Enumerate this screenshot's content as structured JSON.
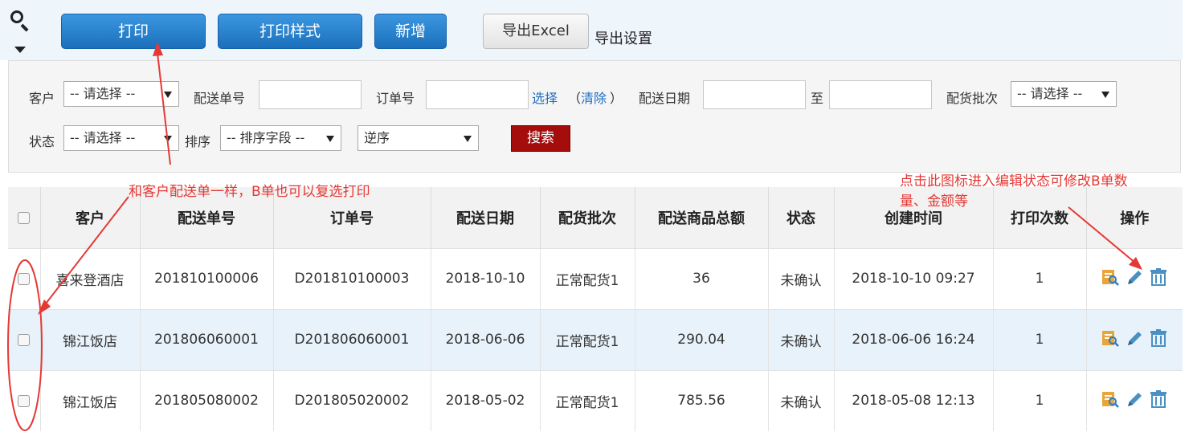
{
  "toolbar": {
    "print_label": "打印",
    "print_style_label": "打印样式",
    "add_label": "新增",
    "export_excel_label": "导出Excel",
    "export_settings_label": "导出设置"
  },
  "filters": {
    "customer_label": "客户",
    "customer_value": "-- 请选择 --",
    "delivery_no_label": "配送单号",
    "order_no_label": "订单号",
    "select_link": "选择",
    "clear_open": "（",
    "clear_link": "清除",
    "clear_close": "）",
    "delivery_date_label": "配送日期",
    "to_label": "至",
    "batch_label": "配货批次",
    "batch_value": "-- 请选择 --",
    "status_label": "状态",
    "status_value": "-- 请选择 --",
    "sort_label": "排序",
    "sort_field_value": "-- 排序字段 --",
    "sort_order_value": "逆序",
    "search_label": "搜索"
  },
  "table": {
    "headers": [
      "客户",
      "配送单号",
      "订单号",
      "配送日期",
      "配货批次",
      "配送商品总额",
      "状态",
      "创建时间",
      "打印次数",
      "操作"
    ],
    "rows": [
      {
        "customer": "喜来登酒店",
        "delivery_no": "201810100006",
        "order_no": "D201810100003",
        "date": "2018-10-10",
        "batch": "正常配货1",
        "amount": "36",
        "status": "未确认",
        "created": "2018-10-10 09:27",
        "prints": "1"
      },
      {
        "customer": "锦江饭店",
        "delivery_no": "201806060001",
        "order_no": "D201806060001",
        "date": "2018-06-06",
        "batch": "正常配货1",
        "amount": "290.04",
        "status": "未确认",
        "created": "2018-06-06 16:24",
        "prints": "1"
      },
      {
        "customer": "锦江饭店",
        "delivery_no": "201805080002",
        "order_no": "D201805020002",
        "date": "2018-05-02",
        "batch": "正常配货1",
        "amount": "785.56",
        "status": "未确认",
        "created": "2018-05-08 12:13",
        "prints": "1"
      }
    ]
  },
  "annotations": {
    "checkbox_note": "和客户配送单一样，B单也可以复选打印",
    "edit_note_line1": "点击此图标进入编辑状态可修改B单数",
    "edit_note_line2": "量、金额等",
    "color": "#e53935"
  },
  "icons": [
    "search-icon",
    "dropdown-arrow-icon",
    "view-detail-icon",
    "edit-pencil-icon",
    "delete-trash-icon"
  ]
}
